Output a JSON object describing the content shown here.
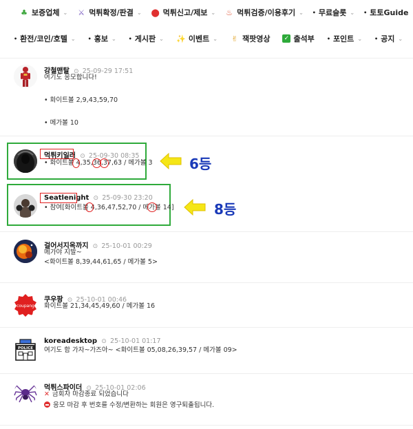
{
  "nav": {
    "row1": [
      {
        "icon": "clover-icon",
        "glyph": "♣",
        "color": "#3ca63c",
        "label": "보증업체",
        "chevron": true
      },
      {
        "icon": "swords-icon",
        "glyph": "⚔",
        "color": "#7a5cc0",
        "label": "먹튀확정/판결",
        "chevron": true
      },
      {
        "icon": "alarm-icon",
        "glyph": "⬤",
        "color": "#e03030",
        "label": "먹튀신고/제보",
        "chevron": true
      },
      {
        "icon": "hot-springs-icon",
        "glyph": "♨",
        "color": "#e05030",
        "label": "먹튀검증/이용후기",
        "chevron": true
      },
      {
        "icon": "bullet",
        "glyph": "•",
        "color": "#222",
        "label": "무료슬롯",
        "chevron": true
      },
      {
        "icon": "bullet",
        "glyph": "•",
        "color": "#222",
        "label": "토토Guide",
        "chevron": true
      }
    ],
    "row2": [
      {
        "icon": "bullet",
        "glyph": "•",
        "color": "#222",
        "label": "환전/코인/호텔",
        "chevron": true
      },
      {
        "icon": "bullet",
        "glyph": "•",
        "color": "#222",
        "label": "홍보",
        "chevron": true
      },
      {
        "icon": "bullet",
        "glyph": "•",
        "color": "#222",
        "label": "게시판",
        "chevron": true
      },
      {
        "icon": "sparkle-icon",
        "glyph": "✨",
        "color": "#e0a020",
        "label": "이벤트",
        "chevron": true
      },
      {
        "icon": "victory-hand-icon",
        "glyph": "✌",
        "color": "#e0a020",
        "label": "잭팟영상",
        "chevron": false
      },
      {
        "icon": "checkbox-icon",
        "glyph": "✓",
        "color": "#2eaa3a",
        "label": "출석부",
        "chevron": false
      },
      {
        "icon": "bullet",
        "glyph": "•",
        "color": "#222",
        "label": "포인트",
        "chevron": true
      },
      {
        "icon": "bullet",
        "glyph": "•",
        "color": "#222",
        "label": "공지",
        "chevron": true
      }
    ]
  },
  "posts": [
    {
      "author": "강철맨탈",
      "date": "25-09-29 17:51",
      "lines": [
        "여기도 응모합니다!",
        "",
        "",
        "• 화이트볼 2,9,43,59,70",
        "",
        "",
        "• 메가볼 10"
      ],
      "avatar": "ironman"
    },
    {
      "author": "먹튀키일러",
      "date": "25-09-30 08:35",
      "lines": [
        "• 화이트볼 4,35,36,37,63 / 메가볼 3"
      ],
      "avatar": "reaper"
    },
    {
      "author": "Seatlenight",
      "date": "25-09-30 23:20",
      "lines": [
        "• 참여[화이트볼 4,36,47,52,70 / 메가볼 14]"
      ],
      "avatar": "boxer"
    },
    {
      "author": "걸어서지옥까지",
      "date": "25-10-01 00:29",
      "lines": [
        "메가야 지발~",
        "<화이트볼 8,39,44,61,65 / 메가볼 5>"
      ],
      "avatar": "fire"
    },
    {
      "author": "쿠우팡",
      "date": "25-10-01 00:46",
      "lines": [
        "화이트볼 21,34,45,49,60 / 메가볼 16"
      ],
      "avatar": "coupang",
      "avatar_text": "coupang"
    },
    {
      "author": "koreadesktop",
      "date": "25-10-01 01:17",
      "lines": [
        "여기도 함 가자~가즈아~ <화이트볼 05,08,26,39,57 / 메가볼 09>"
      ],
      "avatar": "police",
      "avatar_text": "POLICE"
    },
    {
      "author": "먹튀스파이더",
      "date": "25-10-01 02:06",
      "lines": [
        "금회차 마감종료 되었습니다",
        "응모 마감 후 번호를 수정/변환하는 회원은 영구퇴출됩니다."
      ],
      "avatar": "spider"
    }
  ],
  "annotations": {
    "rank1": "6등",
    "rank2": "8등"
  }
}
